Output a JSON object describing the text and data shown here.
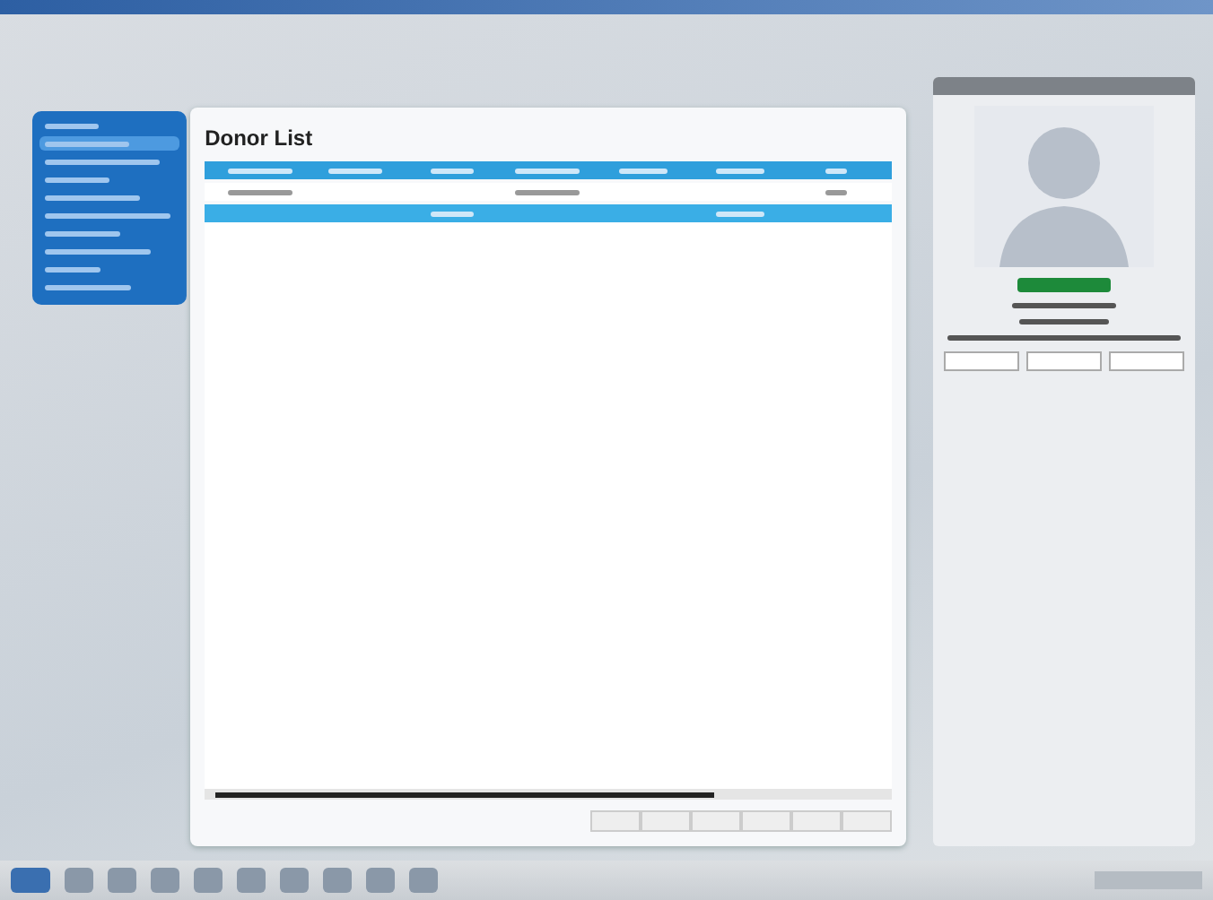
{
  "panel": {
    "title": "Donor List"
  },
  "sidebar": {
    "items": [
      {
        "selected": false
      },
      {
        "selected": true
      },
      {
        "selected": false
      },
      {
        "selected": false
      },
      {
        "selected": false
      },
      {
        "selected": false
      },
      {
        "selected": false
      },
      {
        "selected": false
      },
      {
        "selected": false
      },
      {
        "selected": false
      }
    ]
  },
  "table": {
    "rows": [
      {
        "selected": false
      },
      {
        "selected": true
      }
    ]
  }
}
